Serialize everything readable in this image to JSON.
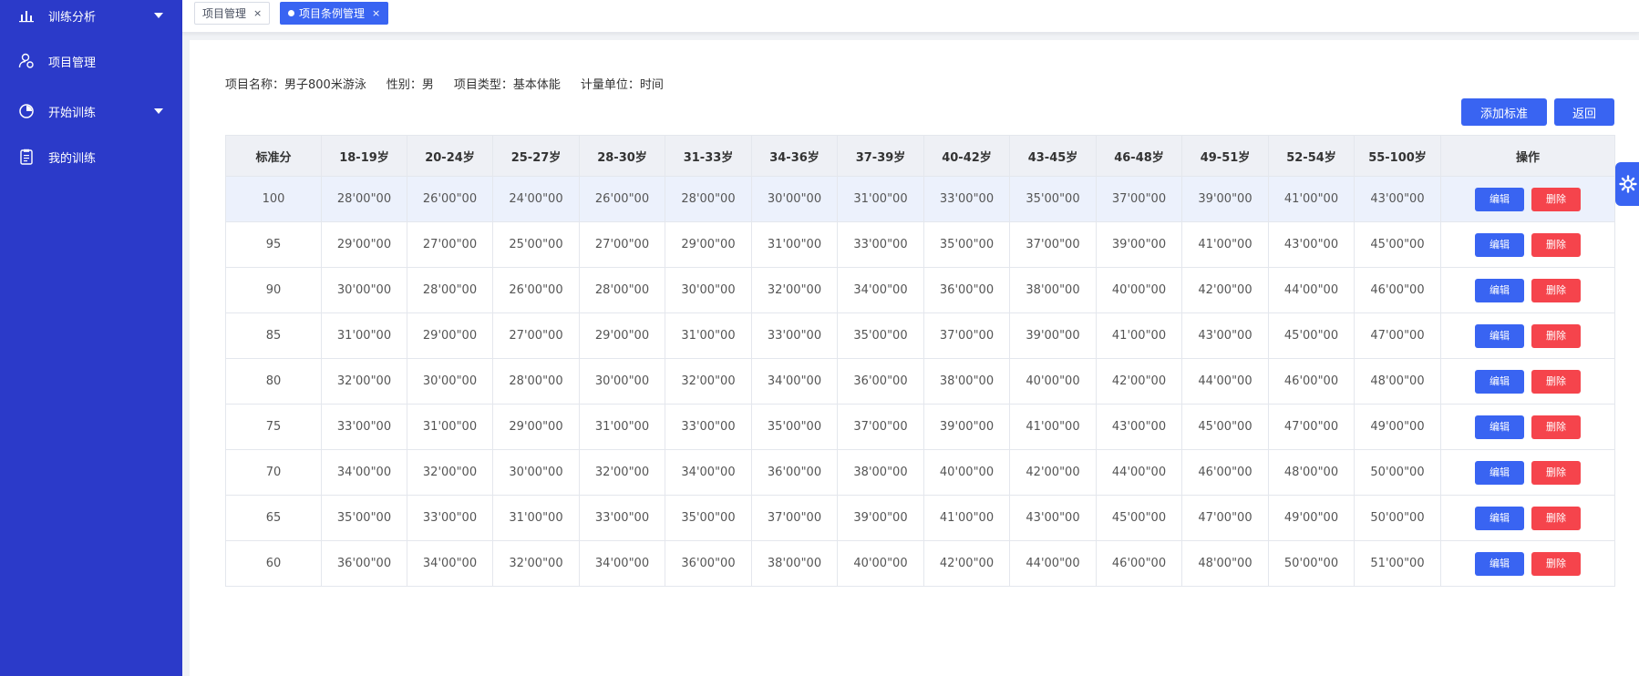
{
  "sidebar": {
    "items": [
      {
        "label": "训练分析",
        "icon": "bar-chart-icon",
        "has_caret": true
      },
      {
        "label": "项目管理",
        "icon": "user-settings-icon",
        "has_caret": false
      },
      {
        "label": "开始训练",
        "icon": "clock-chart-icon",
        "has_caret": true
      },
      {
        "label": "我的训练",
        "icon": "clipboard-icon",
        "has_caret": false
      }
    ]
  },
  "tabs": [
    {
      "label": "项目管理",
      "close": "×",
      "active": false
    },
    {
      "label": "项目条例管理",
      "close": "×",
      "active": true
    }
  ],
  "info": {
    "name": "项目名称：男子800米游泳",
    "gender": "性别：男",
    "type": "项目类型：基本体能",
    "unit": "计量单位：时间"
  },
  "buttons": {
    "add": "添加标准",
    "back": "返回"
  },
  "table": {
    "headers": [
      "标准分",
      "18-19岁",
      "20-24岁",
      "25-27岁",
      "28-30岁",
      "31-33岁",
      "34-36岁",
      "37-39岁",
      "40-42岁",
      "43-45岁",
      "46-48岁",
      "49-51岁",
      "52-54岁",
      "55-100岁",
      "操作"
    ],
    "edit_label": "编辑",
    "delete_label": "删除",
    "rows": [
      [
        "100",
        "28'00\"00",
        "26'00\"00",
        "24'00\"00",
        "26'00\"00",
        "28'00\"00",
        "30'00\"00",
        "31'00\"00",
        "33'00\"00",
        "35'00\"00",
        "37'00\"00",
        "39'00\"00",
        "41'00\"00",
        "43'00\"00"
      ],
      [
        "95",
        "29'00\"00",
        "27'00\"00",
        "25'00\"00",
        "27'00\"00",
        "29'00\"00",
        "31'00\"00",
        "33'00\"00",
        "35'00\"00",
        "37'00\"00",
        "39'00\"00",
        "41'00\"00",
        "43'00\"00",
        "45'00\"00"
      ],
      [
        "90",
        "30'00\"00",
        "28'00\"00",
        "26'00\"00",
        "28'00\"00",
        "30'00\"00",
        "32'00\"00",
        "34'00\"00",
        "36'00\"00",
        "38'00\"00",
        "40'00\"00",
        "42'00\"00",
        "44'00\"00",
        "46'00\"00"
      ],
      [
        "85",
        "31'00\"00",
        "29'00\"00",
        "27'00\"00",
        "29'00\"00",
        "31'00\"00",
        "33'00\"00",
        "35'00\"00",
        "37'00\"00",
        "39'00\"00",
        "41'00\"00",
        "43'00\"00",
        "45'00\"00",
        "47'00\"00"
      ],
      [
        "80",
        "32'00\"00",
        "30'00\"00",
        "28'00\"00",
        "30'00\"00",
        "32'00\"00",
        "34'00\"00",
        "36'00\"00",
        "38'00\"00",
        "40'00\"00",
        "42'00\"00",
        "44'00\"00",
        "46'00\"00",
        "48'00\"00"
      ],
      [
        "75",
        "33'00\"00",
        "31'00\"00",
        "29'00\"00",
        "31'00\"00",
        "33'00\"00",
        "35'00\"00",
        "37'00\"00",
        "39'00\"00",
        "41'00\"00",
        "43'00\"00",
        "45'00\"00",
        "47'00\"00",
        "49'00\"00"
      ],
      [
        "70",
        "34'00\"00",
        "32'00\"00",
        "30'00\"00",
        "32'00\"00",
        "34'00\"00",
        "36'00\"00",
        "38'00\"00",
        "40'00\"00",
        "42'00\"00",
        "44'00\"00",
        "46'00\"00",
        "48'00\"00",
        "50'00\"00"
      ],
      [
        "65",
        "35'00\"00",
        "33'00\"00",
        "31'00\"00",
        "33'00\"00",
        "35'00\"00",
        "37'00\"00",
        "39'00\"00",
        "41'00\"00",
        "43'00\"00",
        "45'00\"00",
        "47'00\"00",
        "49'00\"00",
        "50'00\"00"
      ],
      [
        "60",
        "36'00\"00",
        "34'00\"00",
        "32'00\"00",
        "34'00\"00",
        "36'00\"00",
        "38'00\"00",
        "40'00\"00",
        "42'00\"00",
        "44'00\"00",
        "46'00\"00",
        "48'00\"00",
        "50'00\"00",
        "51'00\"00"
      ]
    ]
  },
  "colors": {
    "sidebar_bg": "#2b3ac9",
    "primary": "#3964f2",
    "danger": "#f5444c",
    "highlight_row": "#ecf1fc"
  },
  "floating": {
    "icon": "gear-icon"
  }
}
